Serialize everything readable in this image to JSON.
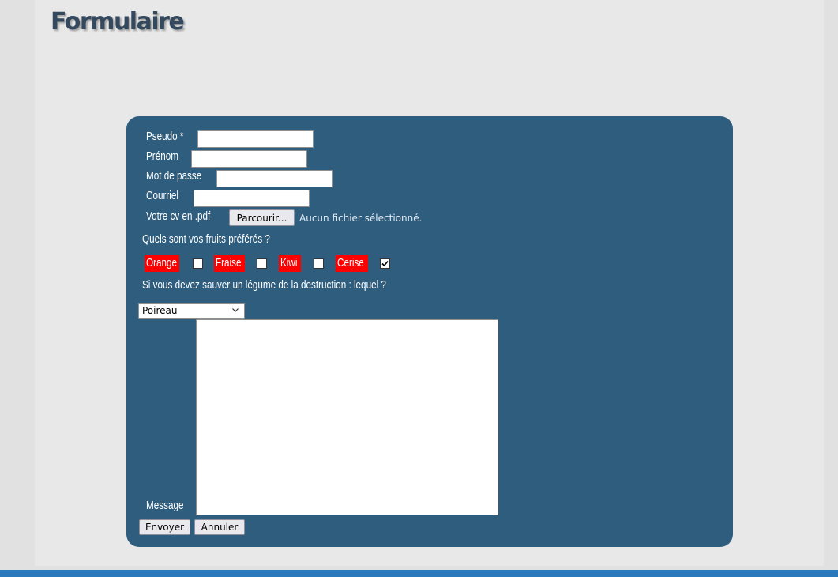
{
  "page": {
    "title": "Formulaire"
  },
  "form": {
    "pseudo_label": "Pseudo *",
    "prenom_label": "Prénom",
    "password_label": "Mot de passe",
    "email_label": "Courriel",
    "cv_label": "Votre cv en .pdf",
    "browse_button": "Parcourir...",
    "no_file_text": "Aucun fichier sélectionné.",
    "fruits_question": "Quels sont vos fruits préférés ?",
    "fruits": [
      {
        "label": "Orange",
        "checked": false
      },
      {
        "label": "Fraise",
        "checked": false
      },
      {
        "label": "Kiwi",
        "checked": false
      },
      {
        "label": "Cerise",
        "checked": true
      }
    ],
    "vegetable_question": "Si vous devez sauver un légume de la destruction : lequel ?",
    "vegetable_selected": "Poireau",
    "message_label": "Message",
    "submit_button": "Envoyer",
    "reset_button": "Annuler"
  },
  "colors": {
    "panel": "#2f5d7e",
    "fruit_highlight": "#ff0000",
    "title": "#34495e",
    "footer_bar": "#2b79bd"
  }
}
